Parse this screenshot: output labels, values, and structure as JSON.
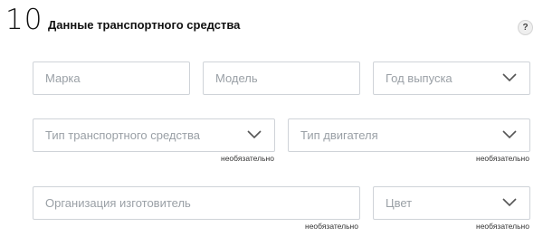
{
  "section": {
    "number": "10",
    "title": "Данные транспортного средства",
    "help_label": "?"
  },
  "fields": {
    "brand": {
      "placeholder": "Марка"
    },
    "model": {
      "placeholder": "Модель"
    },
    "year": {
      "placeholder": "Год выпуска"
    },
    "vehicle_type": {
      "placeholder": "Тип транспортного средства",
      "note": "необязательно"
    },
    "engine_type": {
      "placeholder": "Тип двигателя",
      "note": "необязательно"
    },
    "manufacturer": {
      "placeholder": "Организация изготовитель",
      "note": "необязательно"
    },
    "color": {
      "placeholder": "Цвет",
      "note": "необязательно"
    }
  }
}
